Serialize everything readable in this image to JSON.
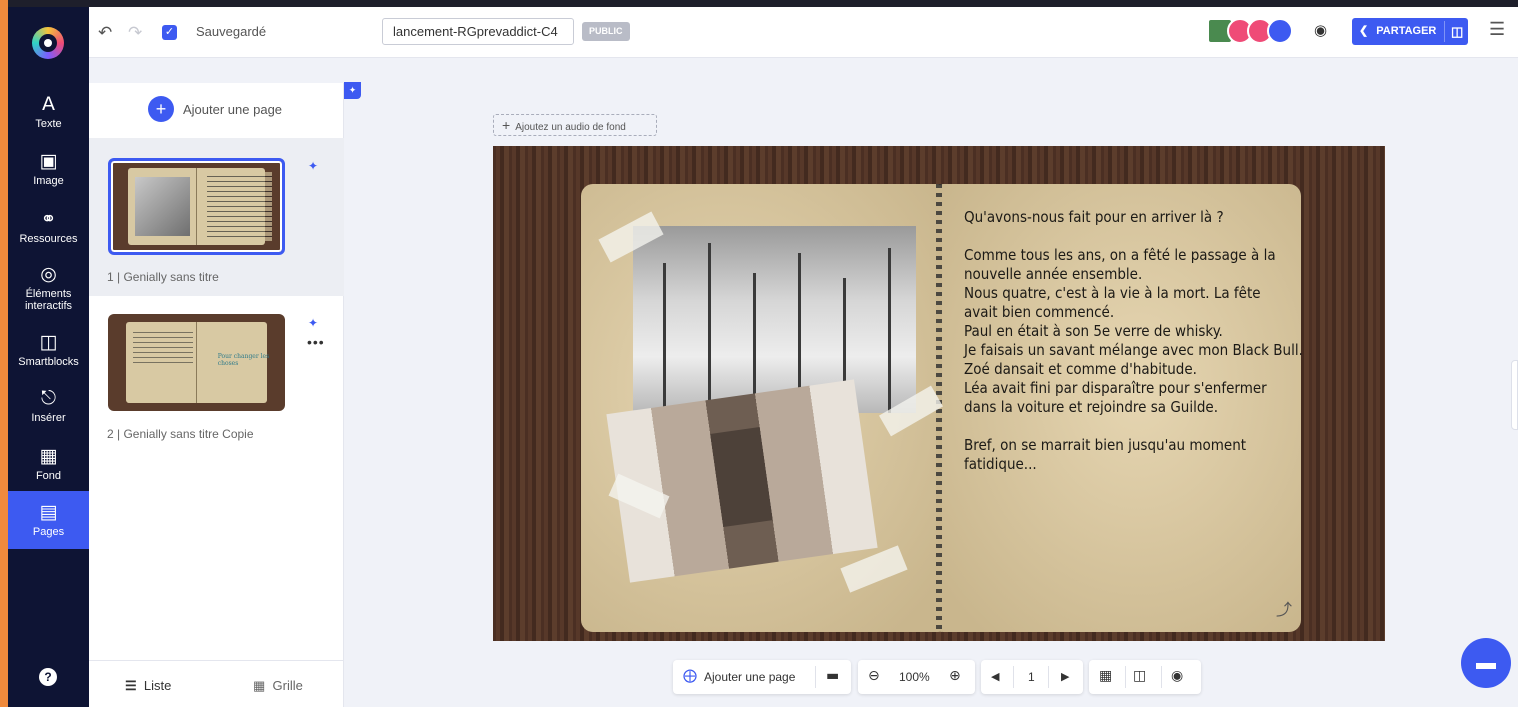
{
  "rail": {
    "items": [
      {
        "label": "Texte",
        "icon": "text-icon"
      },
      {
        "label": "Image",
        "icon": "image-icon"
      },
      {
        "label": "Ressources",
        "icon": "resources-icon"
      },
      {
        "label": "Éléments interactifs",
        "icon": "interactive-icon"
      },
      {
        "label": "Smartblocks",
        "icon": "smartblocks-icon"
      },
      {
        "label": "Insérer",
        "icon": "insert-icon"
      },
      {
        "label": "Fond",
        "icon": "background-icon"
      },
      {
        "label": "Pages",
        "icon": "pages-icon"
      }
    ],
    "help": "?"
  },
  "topbar": {
    "saved": "Sauvegardé",
    "title": "lancement-RGprevaddict-C4",
    "visibility": "PUBLIC",
    "share": "PARTAGER"
  },
  "panel": {
    "add_page": "Ajouter une page",
    "pages": [
      {
        "name": "1 | Genially sans titre"
      },
      {
        "name": "2 | Genially sans titre Copie",
        "note": "Pour changer les choses"
      }
    ],
    "view_list": "Liste",
    "view_grid": "Grille"
  },
  "canvas": {
    "audio": "Ajoutez un audio de fond",
    "story": [
      "Qu'avons-nous fait pour en arriver là ?",
      "",
      "Comme tous les ans, on a fêté le passage à la",
      "nouvelle année ensemble.",
      "Nous quatre, c'est à la vie à la mort. La fête",
      "avait bien commencé.",
      "Paul en était à son 5e verre de whisky.",
      "Je faisais un savant mélange avec mon Black Bull.",
      "Zoé dansait et comme d'habitude.",
      "Léa avait fini par disparaître pour s'enfermer",
      "dans la voiture et rejoindre sa Guilde.",
      "",
      "Bref, on se marrait bien jusqu'au moment",
      "fatidique..."
    ]
  },
  "bottombar": {
    "add_page": "Ajouter une page",
    "zoom": "100%",
    "page_number": "1"
  },
  "colors": {
    "accent": "#3d5af1",
    "rail": "#0e1434",
    "edge": "#f08a3c"
  }
}
